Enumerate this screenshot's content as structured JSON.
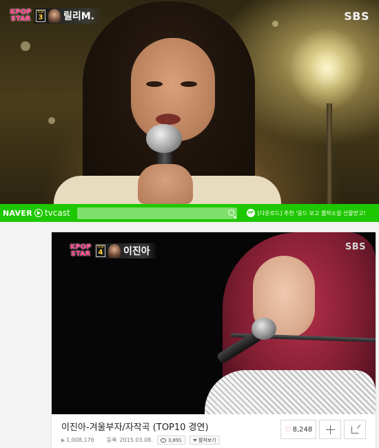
{
  "top_video": {
    "kpop_logo": "KPOP STAR",
    "rank_label": "TOP",
    "rank_number": "3",
    "contestant_name": "릴리M.",
    "broadcaster": "SBS"
  },
  "tvcast_bar": {
    "naver_logo": "NAVER",
    "tvcast_logo": "tvcast",
    "search_placeholder": "",
    "up_badge": "UP",
    "promo_text": "[다운로드] 추천 '응드 보고 웹작소설 선물받고!",
    "brand_color": "#1ec800"
  },
  "video_card": {
    "kpop_logo": "KPOP STAR",
    "rank_label": "TOP",
    "rank_number": "4",
    "contestant_name": "이진아",
    "broadcaster": "SBS",
    "title": "이진아-겨울부자/자작곡 (TOP10 경연)",
    "views": "1,008,176",
    "registered_label": "등록",
    "registered_date": "2015.03.08.",
    "comments": "3,891",
    "view_all_label": "펼쳐보기",
    "likes": "8,248",
    "icons": [
      "play-icon",
      "comment-icon",
      "heart-icon",
      "plus-icon",
      "share-icon"
    ]
  }
}
